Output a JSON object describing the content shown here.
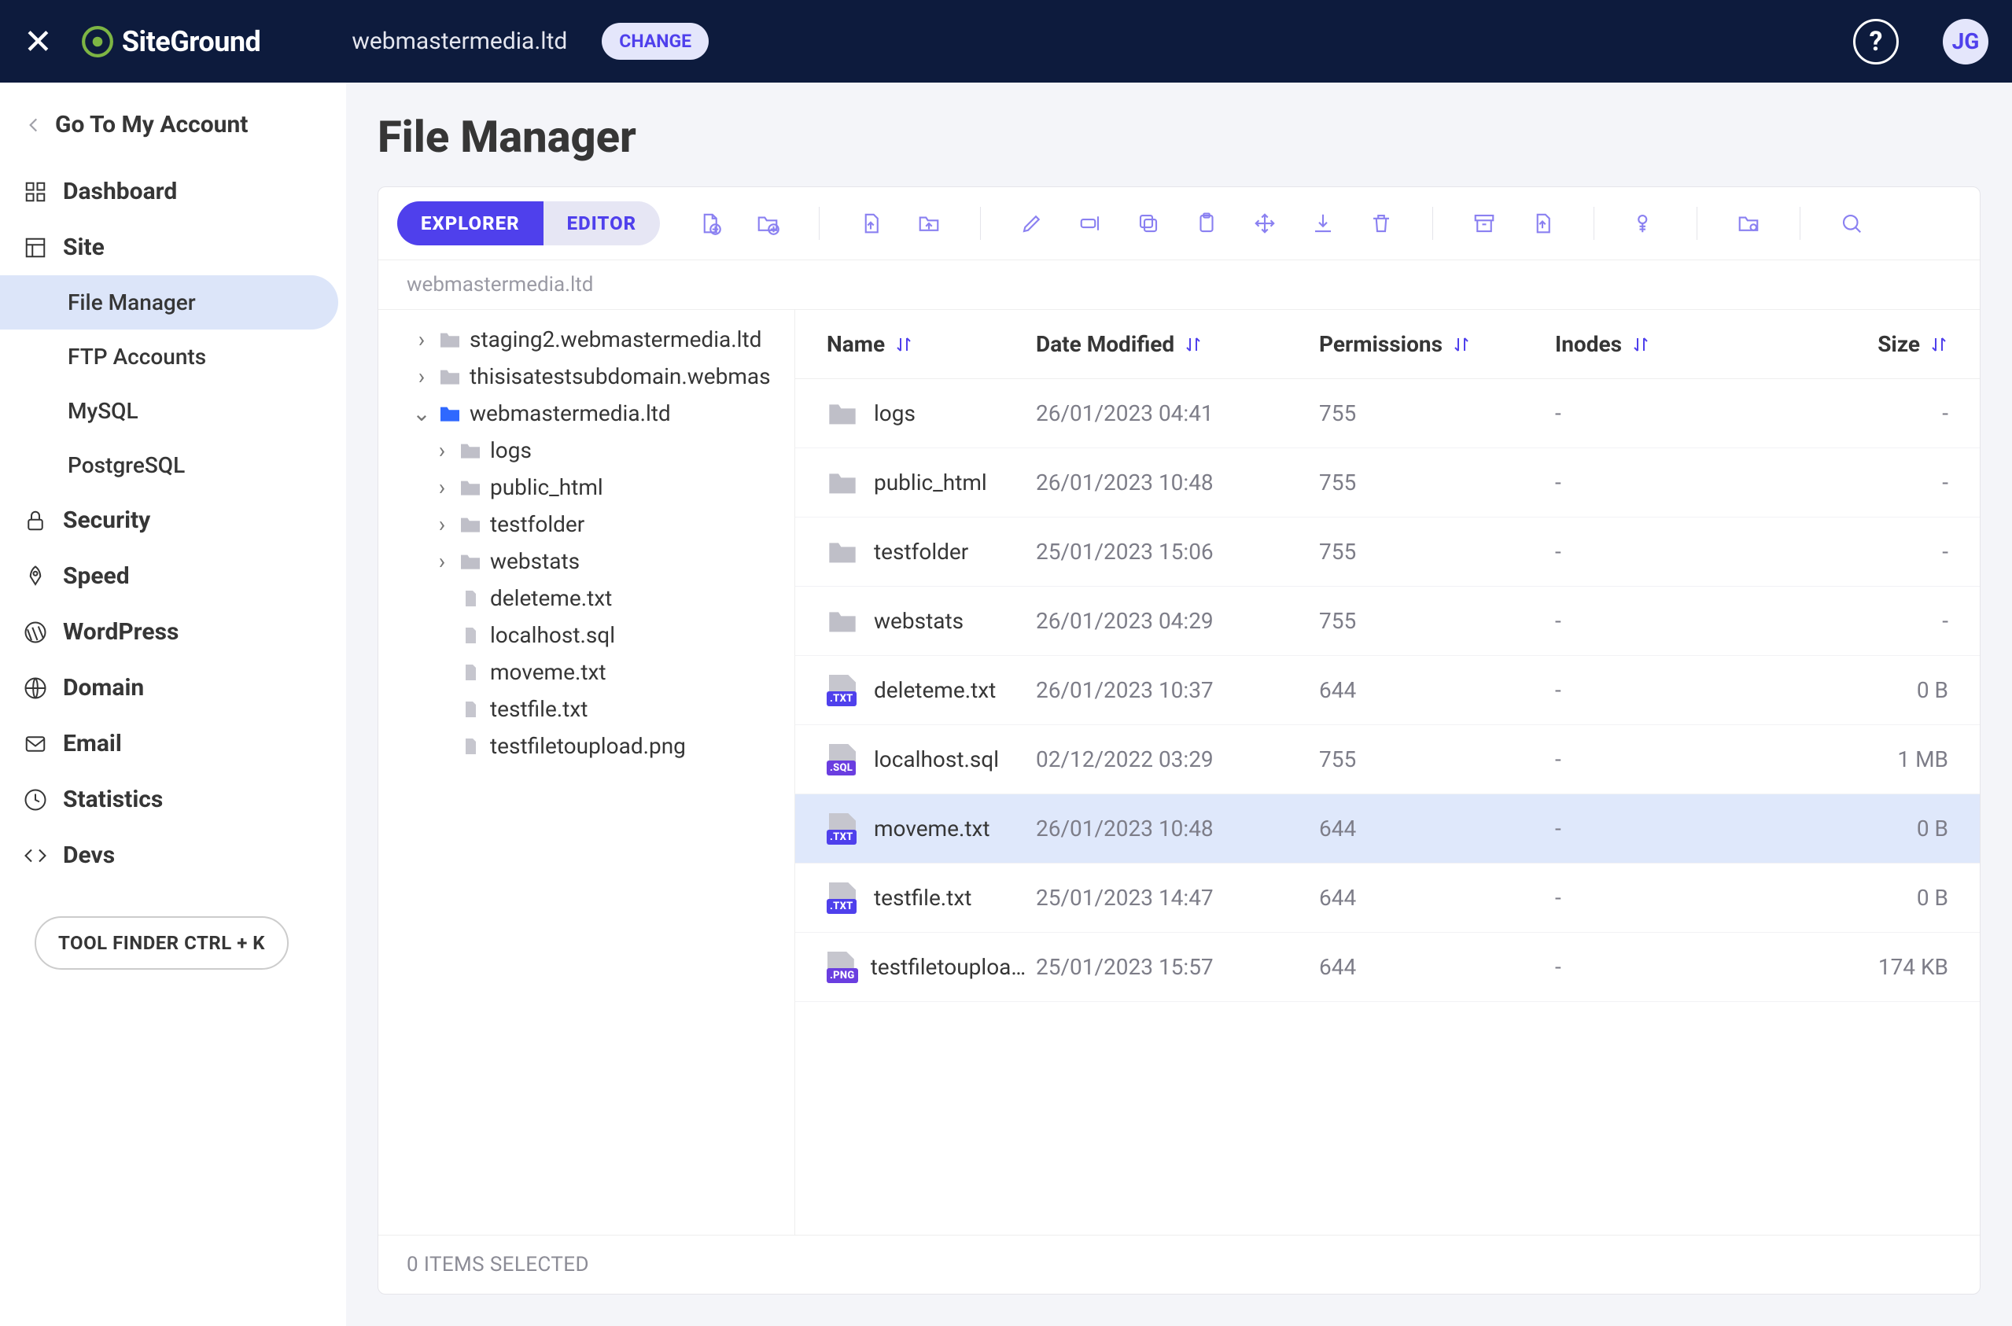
{
  "header": {
    "logo_text": "SiteGround",
    "domain": "webmastermedia.ltd",
    "change_label": "CHANGE",
    "avatar_initials": "JG"
  },
  "sidebar": {
    "back_label": "Go To My Account",
    "items": [
      {
        "key": "dashboard",
        "label": "Dashboard",
        "icon": "grid"
      },
      {
        "key": "site",
        "label": "Site",
        "icon": "layout",
        "children": [
          {
            "key": "file-manager",
            "label": "File Manager",
            "active": true
          },
          {
            "key": "ftp",
            "label": "FTP Accounts"
          },
          {
            "key": "mysql",
            "label": "MySQL"
          },
          {
            "key": "postgres",
            "label": "PostgreSQL"
          }
        ]
      },
      {
        "key": "security",
        "label": "Security",
        "icon": "lock"
      },
      {
        "key": "speed",
        "label": "Speed",
        "icon": "rocket"
      },
      {
        "key": "wordpress",
        "label": "WordPress",
        "icon": "wordpress"
      },
      {
        "key": "domain",
        "label": "Domain",
        "icon": "globe"
      },
      {
        "key": "email",
        "label": "Email",
        "icon": "mail"
      },
      {
        "key": "statistics",
        "label": "Statistics",
        "icon": "clock"
      },
      {
        "key": "devs",
        "label": "Devs",
        "icon": "code"
      }
    ],
    "tool_finder": "TOOL FINDER CTRL + K"
  },
  "page": {
    "title": "File Manager",
    "segments": {
      "explorer": "EXPLORER",
      "editor": "EDITOR"
    },
    "toolbar_icons": [
      "new-file-plus",
      "new-folder-plus",
      "sep",
      "upload-file",
      "upload-folder",
      "sep",
      "edit",
      "rename",
      "copy",
      "paste",
      "move",
      "download",
      "delete",
      "sep",
      "archive",
      "extract",
      "sep",
      "permissions",
      "sep",
      "settings",
      "sep",
      "search"
    ],
    "breadcrumb": "webmastermedia.ltd",
    "columns": {
      "name": "Name",
      "date": "Date Modified",
      "perm": "Permissions",
      "inodes": "Inodes",
      "size": "Size"
    },
    "status": "0 ITEMS SELECTED"
  },
  "tree": [
    {
      "label": "staging2.webmastermedia.ltd",
      "type": "folder",
      "expand": "collapsed",
      "level": 0
    },
    {
      "label": "thisisatestsubdomain.webmas",
      "type": "folder",
      "expand": "collapsed",
      "level": 0
    },
    {
      "label": "webmastermedia.ltd",
      "type": "folder",
      "expand": "expanded",
      "level": 0,
      "active": true
    },
    {
      "label": "logs",
      "type": "folder",
      "expand": "collapsed",
      "level": 1
    },
    {
      "label": "public_html",
      "type": "folder",
      "expand": "collapsed",
      "level": 1
    },
    {
      "label": "testfolder",
      "type": "folder",
      "expand": "collapsed",
      "level": 1
    },
    {
      "label": "webstats",
      "type": "folder",
      "expand": "collapsed",
      "level": 1
    },
    {
      "label": "deleteme.txt",
      "type": "file",
      "level": 1
    },
    {
      "label": "localhost.sql",
      "type": "file",
      "level": 1
    },
    {
      "label": "moveme.txt",
      "type": "file",
      "level": 1
    },
    {
      "label": "testfile.txt",
      "type": "file",
      "level": 1
    },
    {
      "label": "testfiletoupload.png",
      "type": "file",
      "level": 1
    }
  ],
  "rows": [
    {
      "name": "logs",
      "type": "folder",
      "date": "26/01/2023 04:41",
      "perm": "755",
      "inodes": "-",
      "size": "-"
    },
    {
      "name": "public_html",
      "type": "folder",
      "date": "26/01/2023 10:48",
      "perm": "755",
      "inodes": "-",
      "size": "-"
    },
    {
      "name": "testfolder",
      "type": "folder",
      "date": "25/01/2023 15:06",
      "perm": "755",
      "inodes": "-",
      "size": "-"
    },
    {
      "name": "webstats",
      "type": "folder",
      "date": "26/01/2023 04:29",
      "perm": "755",
      "inodes": "-",
      "size": "-"
    },
    {
      "name": "deleteme.txt",
      "type": "txt",
      "date": "26/01/2023 10:37",
      "perm": "644",
      "inodes": "-",
      "size": "0 B"
    },
    {
      "name": "localhost.sql",
      "type": "sql",
      "date": "02/12/2022 03:29",
      "perm": "755",
      "inodes": "-",
      "size": "1 MB"
    },
    {
      "name": "moveme.txt",
      "type": "txt",
      "date": "26/01/2023 10:48",
      "perm": "644",
      "inodes": "-",
      "size": "0 B",
      "hover": true
    },
    {
      "name": "testfile.txt",
      "type": "txt",
      "date": "25/01/2023 14:47",
      "perm": "644",
      "inodes": "-",
      "size": "0 B"
    },
    {
      "name": "testfiletoupload.p…",
      "type": "png",
      "date": "25/01/2023 15:57",
      "perm": "644",
      "inodes": "-",
      "size": "174 KB"
    }
  ]
}
